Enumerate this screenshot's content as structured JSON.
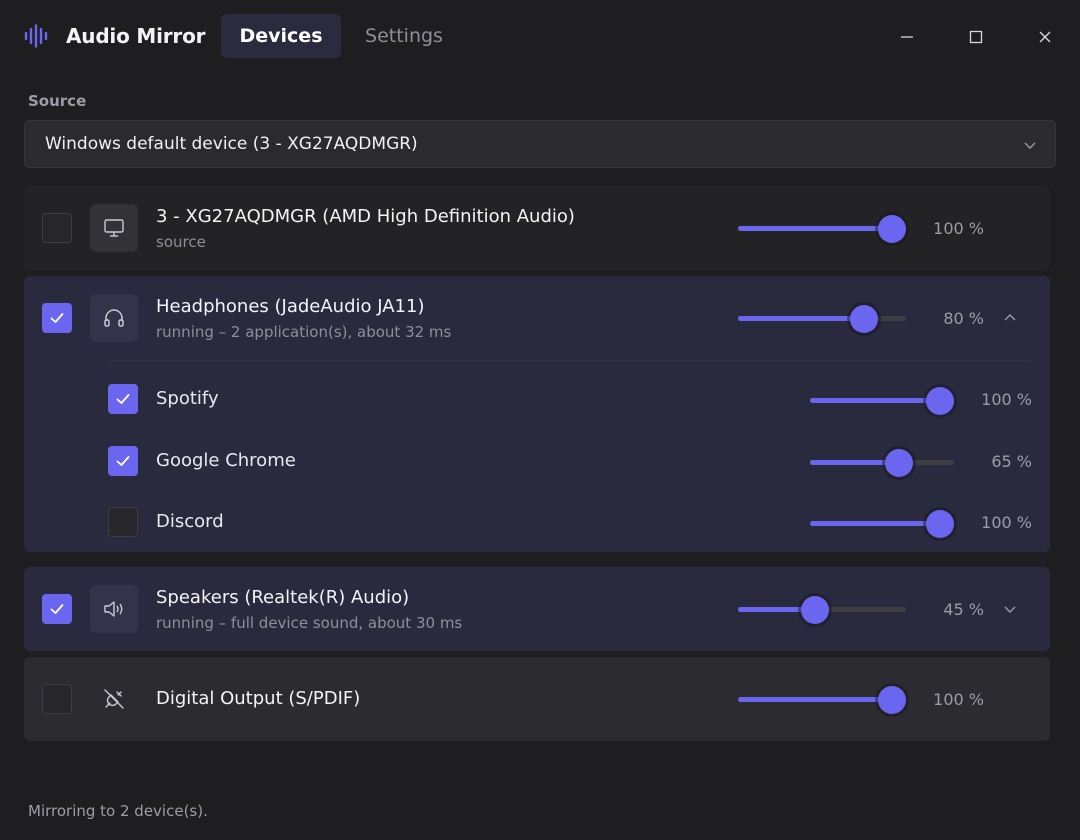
{
  "app": {
    "title": "Audio Mirror",
    "accent_color": "#6b66f0",
    "logo_icon": "sound-wave-icon"
  },
  "tabs": [
    {
      "label": "Devices",
      "active": true
    },
    {
      "label": "Settings",
      "active": false
    }
  ],
  "window_controls": [
    "minimize-icon",
    "maximize-icon",
    "close-icon"
  ],
  "source": {
    "label": "Source",
    "selected": "Windows default device (3 - XG27AQDMGR)"
  },
  "devices": [
    {
      "name": "3 - XG27AQDMGR (AMD High Definition Audio)",
      "status": "source",
      "checked": false,
      "icon": "monitor-icon",
      "volume": 100,
      "volume_label": "100 %"
    },
    {
      "name": "Headphones (JadeAudio JA11)",
      "status": "running – 2 application(s), about 32 ms",
      "checked": true,
      "icon": "headphones-icon",
      "volume": 80,
      "volume_label": "80 %",
      "expanded": true,
      "apps": [
        {
          "name": "Spotify",
          "checked": true,
          "volume": 100,
          "volume_label": "100 %"
        },
        {
          "name": "Google Chrome",
          "checked": true,
          "volume": 65,
          "volume_label": "65 %"
        },
        {
          "name": "Discord",
          "checked": false,
          "volume": 100,
          "volume_label": "100 %"
        }
      ]
    },
    {
      "name": "Speakers (Realtek(R) Audio)",
      "status": "running – full device sound, about 30 ms",
      "checked": true,
      "icon": "speaker-icon",
      "volume": 45,
      "volume_label": "45 %",
      "expanded": false
    },
    {
      "name": "Digital Output (S/PDIF)",
      "status": "",
      "checked": false,
      "icon": "digital-output-icon",
      "volume": 100,
      "volume_label": "100 %"
    }
  ],
  "footer": {
    "status": "Mirroring to 2 device(s)."
  }
}
